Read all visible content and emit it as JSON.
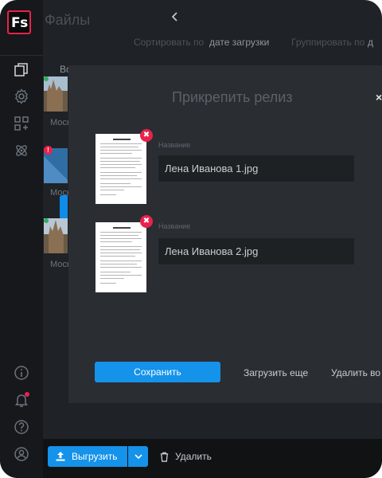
{
  "app": {
    "logo_text": "Fs",
    "logo_accent": "#e8234a"
  },
  "header": {
    "title": "Файлы",
    "sort_label": "Сортировать по",
    "sort_value": "дате загрузки",
    "group_label": "Группировать по",
    "group_value": "д"
  },
  "sidebar": {
    "icons": [
      "files-icon",
      "settings-icon",
      "apps-icon",
      "atom-icon",
      "info-icon",
      "bell-icon",
      "help-icon",
      "user-icon"
    ],
    "notification_dot_color": "#e8234a"
  },
  "list": {
    "header": "Вс",
    "items": [
      {
        "caption": "Моск",
        "status": "green"
      },
      {
        "caption": "Моск",
        "status": "red"
      },
      {
        "caption": "Моск",
        "status": "green"
      }
    ]
  },
  "modal": {
    "title": "Прикрепить релиз",
    "close_symbol": "×",
    "remove_symbol": "✖",
    "files": [
      {
        "label": "Название",
        "value": "Лена Иванова 1.jpg"
      },
      {
        "label": "Название",
        "value": "Лена Иванова 2.jpg"
      }
    ],
    "save_button": "Сохранить",
    "upload_more": "Загрузить еще",
    "delete_all": "Удалить во"
  },
  "bottombar": {
    "upload_button": "Выгрузить",
    "delete_button": "Удалить"
  },
  "colors": {
    "accent": "#1592ea",
    "danger": "#e8234a",
    "background": "#1f2226"
  }
}
